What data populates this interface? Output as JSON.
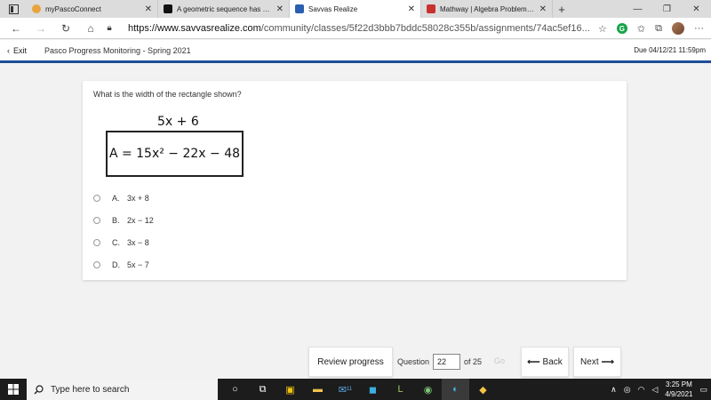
{
  "browser": {
    "tabs": [
      {
        "title": "myPascoConnect",
        "active": false
      },
      {
        "title": "A geometric sequence has an init",
        "active": false
      },
      {
        "title": "Savvas Realize",
        "active": true
      },
      {
        "title": "Mathway | Algebra Problem Solve",
        "active": false
      }
    ],
    "new_tab": "+",
    "window_controls": {
      "minimize": "—",
      "restore": "❐",
      "close": "✕"
    },
    "url": "https://www.savvasrealize.com/community/classes/5f22d3bbb7bddc58028c355b/assignments/74ac5ef16...",
    "url_host": "https://www.savvasrealize.com",
    "url_rest": "/community/classes/5f22d3bbb7bddc58028c355b/assignments/74ac5ef16..."
  },
  "header": {
    "exit_label": "Exit",
    "course_title": "Pasco Progress Monitoring - Spring 2021",
    "due": "Due 04/12/21 11:59pm"
  },
  "question": {
    "prompt": "What is the width of the rectangle shown?",
    "dimension_label": "5x + 6",
    "area_label": "A = 15x² − 22x − 48",
    "choices": [
      {
        "letter": "A.",
        "text": "3x + 8"
      },
      {
        "letter": "B.",
        "text": "2x − 12"
      },
      {
        "letter": "C.",
        "text": "3x − 8"
      },
      {
        "letter": "D.",
        "text": "5x − 7"
      }
    ]
  },
  "footer": {
    "review_label": "Review progress",
    "question_label": "Question",
    "question_value": "22",
    "of_label": "of 25",
    "go_label": "Go",
    "back_label": "Back",
    "next_label": "Next"
  },
  "taskbar": {
    "search_placeholder": "Type here to search",
    "mail_badge": "11",
    "time": "3:25 PM",
    "date": "4/9/2021"
  },
  "colors": {
    "accent_bar": "#1f4e96",
    "taskbar": "#1c1c1c"
  }
}
